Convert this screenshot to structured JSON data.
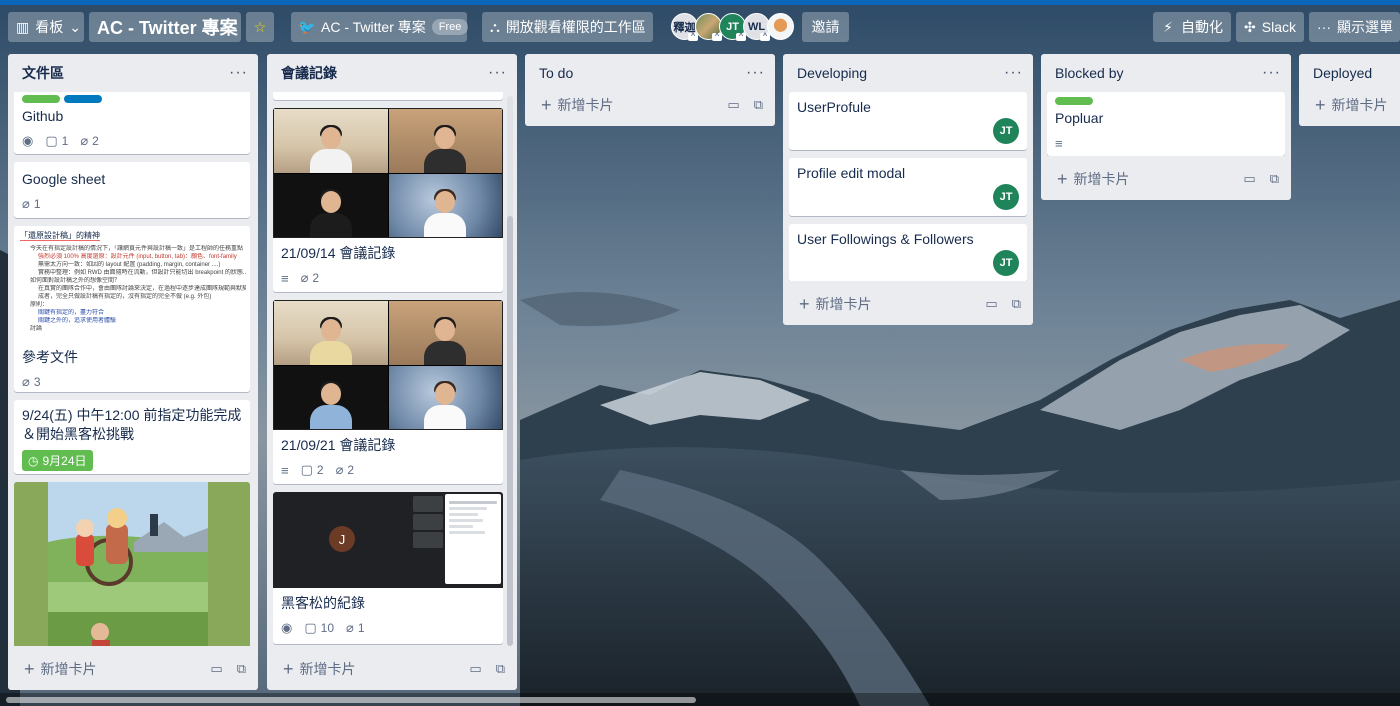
{
  "header": {
    "board_menu_label": "看板",
    "board_title": "AC - Twitter 專案",
    "workspace_name": "AC - Twitter 專案",
    "workspace_plan": "Free",
    "visibility_label": "開放觀看權限的工作區",
    "members": [
      {
        "initials": "釋迦",
        "style": "plain"
      },
      {
        "initials": "",
        "style": "photo1"
      },
      {
        "initials": "JT",
        "style": "green"
      },
      {
        "initials": "WL",
        "style": "plain"
      },
      {
        "initials": "",
        "style": "photo2"
      }
    ],
    "invite_label": "邀請",
    "automation_label": "自動化",
    "slack_label": "Slack",
    "menu_label": "顯示選單"
  },
  "lists": [
    {
      "title": "文件區",
      "footer_add": "新增卡片",
      "cards": [
        {
          "title": "Github",
          "labels": [
            "#61bd4f",
            "#0079bf"
          ],
          "badges": {
            "watch": true,
            "comments": "1",
            "attachments": "2"
          }
        },
        {
          "title": "Google sheet",
          "badges": {
            "attachments": "1"
          }
        },
        {
          "title": "參考文件",
          "badges": {
            "attachments": "3"
          },
          "cover_doc": {
            "heading": "「還原設計稿」的精神",
            "lines": [
              "今天在有指定設計稿的情況下，「讓網頁元件與設計稿一致」是工程師的任務重點",
              "強烈必須 100% 高度還原：設計元件 (input, button, tab)：顏色、font-family",
              "無需太方向一致：如因的 layout 配置 (padding, margin, container ....)",
              "實務中整理：例如 RWD 由面隨時在流動，但設計只能切出 breakpoint 的狀態...",
              "如何面對設計稿之外的想像空間？",
              "在真實的團隊合作中，會由團隊討論來決定，在過程中逐步達成團隊規範與默契",
              "成者，完全只做設計稿有指定的，沒有指定的完全不做 (e.g. 外包)",
              "原則：",
              "關鍵有指定的，盡力符合",
              "關鍵之外的，追求使用者體驗",
              "討論"
            ]
          }
        },
        {
          "title": "9/24(五) 中午12:00 前指定功能完成＆開始黑客松挑戰",
          "due": "9月24日"
        },
        {
          "title": "",
          "cover_anime": true
        }
      ]
    },
    {
      "title": "會議記錄",
      "footer_add": "新增卡片",
      "cards": [
        {
          "title": "21/09/14 會議記錄",
          "badges": {
            "description": true,
            "attachments": "2"
          }
        },
        {
          "title": "21/09/21 會議記錄",
          "badges": {
            "description": true,
            "comments": "2",
            "attachments": "2"
          }
        },
        {
          "title": "黑客松的紀錄",
          "badges": {
            "watch": true,
            "comments": "10",
            "attachments": "1"
          },
          "zoom_initial": "J"
        }
      ]
    },
    {
      "title": "To do",
      "footer_add": "新增卡片",
      "cards": []
    },
    {
      "title": "Developing",
      "footer_add": "新增卡片",
      "cards": [
        {
          "title": "UserProfule",
          "member": "JT"
        },
        {
          "title": "Profile edit modal",
          "member": "JT"
        },
        {
          "title": "User Followings & Followers",
          "member": "JT"
        }
      ]
    },
    {
      "title": "Blocked by",
      "footer_add": "新增卡片",
      "cards": [
        {
          "title": "Popluar",
          "labels": [
            "#61bd4f"
          ],
          "badges": {
            "description": true
          }
        }
      ]
    },
    {
      "title": "Deployed",
      "footer_add": "新增卡片",
      "cards": []
    }
  ],
  "icons": {
    "watch": "eye-icon",
    "comments": "comment-icon",
    "attachments": "paperclip-icon",
    "description": "description-icon",
    "template": "template-card-icon",
    "clock": "clock-icon"
  },
  "colors": {
    "header_strip": "#0c66b9",
    "list_bg": "#ebecf0",
    "member_green": "#1f845a",
    "due_green": "#61bd4f",
    "label_blue": "#0079bf"
  }
}
